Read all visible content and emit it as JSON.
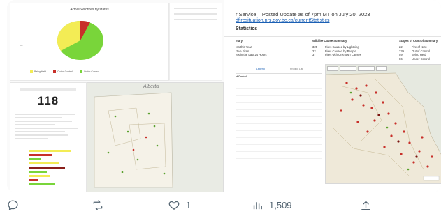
{
  "left_image": {
    "chart_title": "Active Wildfires by status",
    "legend": [
      "Being Held",
      "Out of Control",
      "Under Control"
    ],
    "pie_colors": {
      "green": "#79d53a",
      "yellow": "#f3ec55",
      "red": "#c8302a"
    },
    "big_number": "118",
    "map_label": "Alberta"
  },
  "right_image": {
    "title_prefix": "r Service – Posted Update as of 7pm MT on July 20, ",
    "title_year": "2023",
    "link": "dfiresituation.nrs.gov.bc.ca/currentStatistics",
    "section": "Statistics",
    "summary_table": {
      "header": "mary",
      "rows": [
        "res this Year",
        "ctive Fires",
        "res in the Last 24 Hours"
      ]
    },
    "cause_table": {
      "header": "Wildfire Cause Summary",
      "rows": [
        {
          "n": "325",
          "label": "Fires Caused by Lightning"
        },
        {
          "n": "22",
          "label": "Fires Caused by People"
        },
        {
          "n": "37",
          "label": "Fires with Unknown Causes"
        }
      ]
    },
    "stages_table": {
      "header": "Stages of Control Summary",
      "rows": [
        {
          "n": "22",
          "label": "Fire of Note"
        },
        {
          "n": "239",
          "label": "Out of Control"
        },
        {
          "n": "59",
          "label": "Being Held"
        },
        {
          "n": "86",
          "label": "Under Control"
        }
      ]
    },
    "tabs": [
      "Legend",
      "Product List"
    ],
    "list_header": "of Control"
  },
  "actions": {
    "reply_count": "",
    "repost_count": "",
    "like_count": "1",
    "views_count": "1,509"
  },
  "colors": {
    "icon": "#536471",
    "link": "#1a5fb4"
  }
}
